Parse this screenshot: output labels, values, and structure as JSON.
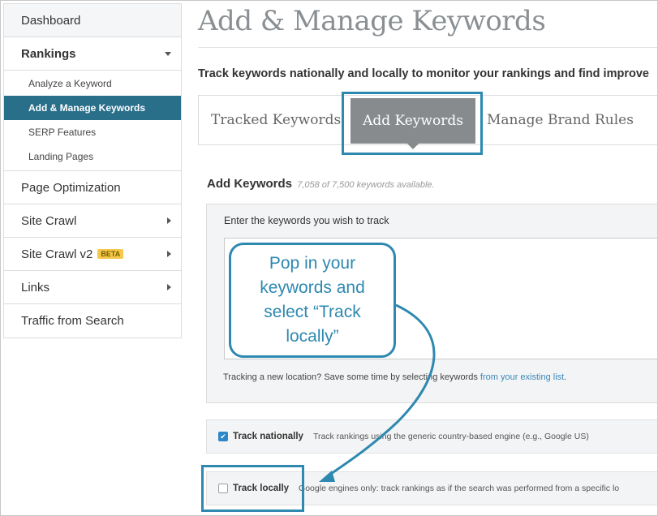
{
  "sidebar": {
    "dashboard": "Dashboard",
    "rankings": "Rankings",
    "rankings_subitems": [
      "Analyze a Keyword",
      "Add & Manage Keywords",
      "SERP Features",
      "Landing Pages"
    ],
    "active_subitem": "Add & Manage Keywords",
    "page_optimization": "Page Optimization",
    "site_crawl": "Site Crawl",
    "site_crawl_v2": "Site Crawl v2",
    "beta_badge": "BETA",
    "links": "Links",
    "traffic_from_search": "Traffic from Search"
  },
  "main": {
    "title": "Add & Manage Keywords",
    "subtitle": "Track keywords nationally and locally to monitor your rankings and find improve",
    "tabs": {
      "tracked": "Tracked Keywords",
      "add": "Add Keywords",
      "manage_brand": "Manage Brand Rules"
    },
    "add_keywords": {
      "heading": "Add Keywords",
      "availability": "7,058 of 7,500 keywords available.",
      "prompt": "Enter the keywords you wish to track",
      "tip_prefix": "Tracking a new location? Save some time by selecting keywords ",
      "tip_link": "from your existing list",
      "tip_suffix": "."
    },
    "track_options": {
      "nationally": {
        "label": "Track nationally",
        "checked": true,
        "description": "Track rankings using the generic country-based engine (e.g., Google US)"
      },
      "locally": {
        "label": "Track locally",
        "checked": false,
        "description": "Google engines only: track rankings as if the search was performed from a specific lo"
      }
    }
  },
  "callout": {
    "text": "Pop in your\nkeywords and\nselect “Track\nlocally”"
  },
  "colors": {
    "accent": "#2e88b0",
    "active_nav": "#2a6f8a",
    "active_tab": "#878b8e",
    "checkbox": "#2d86c8",
    "beta": "#f4c84a"
  },
  "icons": {
    "rankings_expand": "chevron-down-icon",
    "submenu_expand": "chevron-right-icon",
    "checkbox_checked": "checkmark-icon"
  }
}
